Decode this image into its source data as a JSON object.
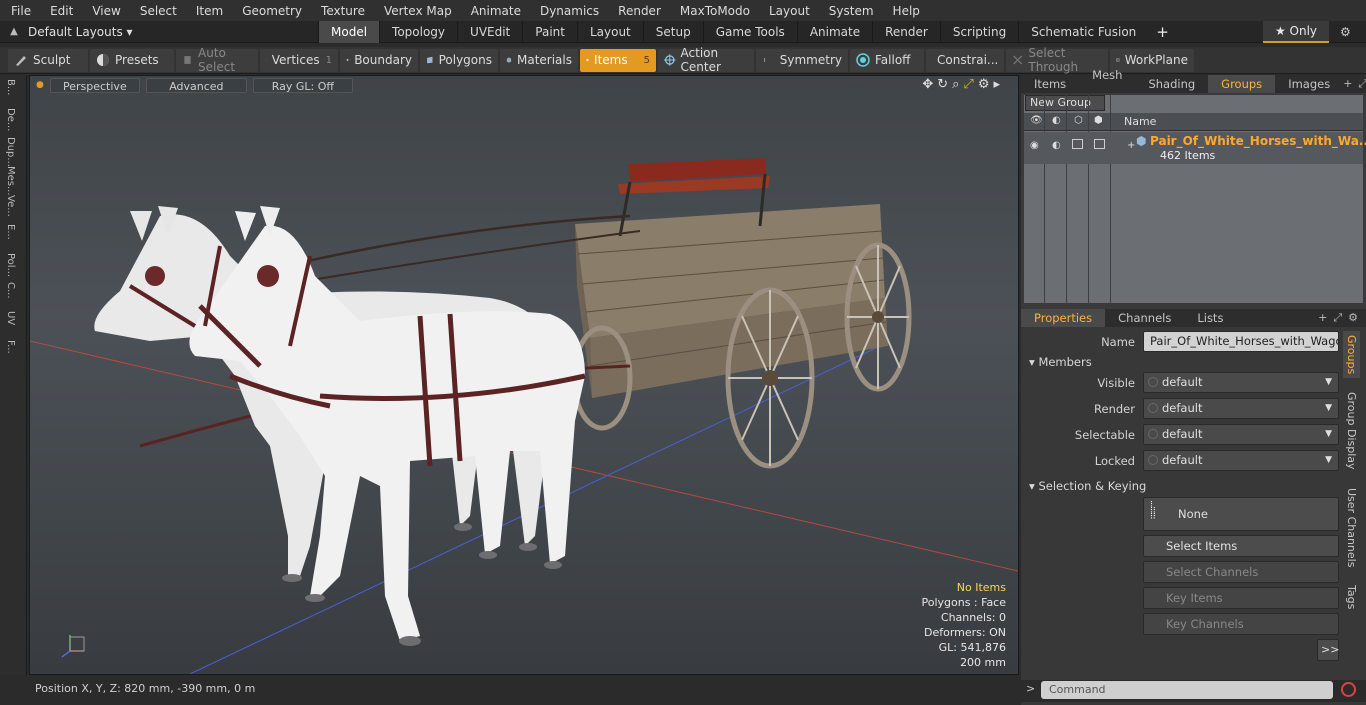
{
  "menu": [
    "File",
    "Edit",
    "View",
    "Select",
    "Item",
    "Geometry",
    "Texture",
    "Vertex Map",
    "Animate",
    "Dynamics",
    "Render",
    "MaxToModo",
    "Layout",
    "System",
    "Help"
  ],
  "layout": {
    "selector": "Default Layouts",
    "tabs": [
      "Model",
      "Topology",
      "UVEdit",
      "Paint",
      "Layout",
      "Setup",
      "Game Tools",
      "Animate",
      "Render",
      "Scripting",
      "Schematic Fusion"
    ],
    "active_tab": "Model",
    "only_label": "Only"
  },
  "toolbar": {
    "sculpt": "Sculpt",
    "presets": "Presets",
    "auto_select": "Auto Select",
    "vertices": "Vertices",
    "vertices_count": "1",
    "boundary": "Boundary",
    "polygons": "Polygons",
    "materials": "Materials",
    "items": "Items",
    "items_count": "5",
    "action_center": "Action Center",
    "symmetry": "Symmetry",
    "falloff": "Falloff",
    "constraints": "Constrai...",
    "select_through": "Select Through",
    "workplane": "WorkPlane"
  },
  "left_tools": [
    "B...",
    "De...",
    "Dup...",
    "Mes...",
    "Ve...",
    "E...",
    "Pol...",
    "C...",
    "UV",
    "F..."
  ],
  "viewport": {
    "view_mode": "Perspective",
    "advanced": "Advanced",
    "raygl": "Ray GL: Off",
    "info": {
      "selection": "No Items",
      "polygons": "Polygons : Face",
      "channels": "Channels: 0",
      "deformers": "Deformers: ON",
      "gl": "GL: 541,876",
      "scale": "200 mm"
    }
  },
  "status": {
    "position": "Position X, Y, Z:  820 mm, -390 mm, 0 m"
  },
  "top_panel": {
    "tabs": [
      "Items",
      "Mesh ...",
      "Shading",
      "Groups",
      "Images"
    ],
    "active_tab": "Groups",
    "new_group": "New Group",
    "name_header": "Name",
    "group_name": "Pair_Of_White_Horses_with_Wa...",
    "group_count": "462 Items"
  },
  "properties": {
    "tabs": [
      "Properties",
      "Channels",
      "Lists"
    ],
    "active_tab": "Properties",
    "name_label": "Name",
    "name_value": "Pair_Of_White_Horses_with_Wagon (",
    "members_section": "Members",
    "visible_label": "Visible",
    "visible_value": "default",
    "render_label": "Render",
    "render_value": "default",
    "selectable_label": "Selectable",
    "selectable_value": "default",
    "locked_label": "Locked",
    "locked_value": "default",
    "sel_keying_section": "Selection & Keying",
    "none_button": "None",
    "select_items": "Select Items",
    "select_channels": "Select Channels",
    "key_items": "Key Items",
    "key_channels": "Key Channels",
    "more": ">>",
    "side_tabs": [
      "Groups",
      "Group Display",
      "User Channels",
      "Tags"
    ]
  },
  "command": {
    "placeholder": "Command"
  },
  "colors": {
    "accent": "#e39a20",
    "highlight_text": "#ffa82c"
  }
}
